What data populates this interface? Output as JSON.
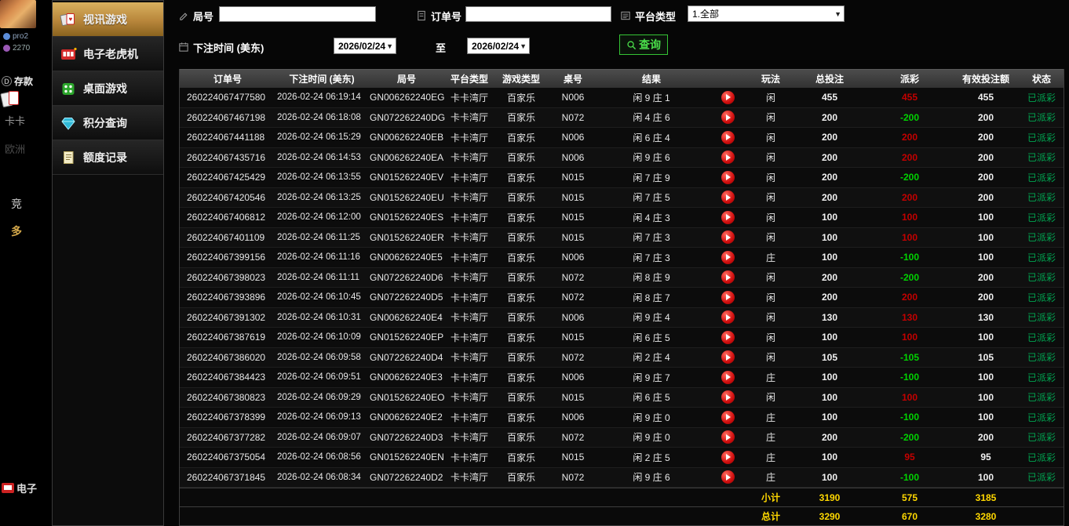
{
  "colors": {
    "accent_gold": "#c9a24f",
    "win_red": "#c40000",
    "loss_green": "#00d300",
    "status_green": "#00a651",
    "summary_yellow": "#ffd800",
    "search_green": "#35c435"
  },
  "background": {
    "username": "pro2",
    "user_id": "2270",
    "deposit_label": "存款",
    "nav_fragments": [
      "卡卡",
      "欧洲",
      "竞",
      "多"
    ],
    "bottom_label": "电子"
  },
  "sidebar": {
    "items": [
      {
        "label": "视讯游戏"
      },
      {
        "label": "电子老虎机"
      },
      {
        "label": "桌面游戏"
      },
      {
        "label": "积分查询"
      },
      {
        "label": "额度记录"
      }
    ]
  },
  "filters": {
    "round_label": "局号",
    "order_label": "订单号",
    "platform_label": "平台类型",
    "platform_value": "1.全部",
    "bet_time_label": "下注时间 (美东)",
    "date_from": "2026/02/24",
    "to_label": "至",
    "date_to": "2026/02/24",
    "search_label": "查询"
  },
  "table": {
    "headers": [
      "订单号",
      "下注时间 (美东)",
      "局号",
      "平台类型",
      "游戏类型",
      "桌号",
      "结果",
      "",
      "玩法",
      "总投注",
      "派彩",
      "有效投注额",
      "状态"
    ],
    "rows": [
      {
        "order": "260224067477580",
        "time": "2026-02-24 06:19:14",
        "round": "GN006262240EG",
        "platform": "卡卡湾厅",
        "game": "百家乐",
        "table": "N006",
        "result": "闲 9 庄 1",
        "bet_on": "闲",
        "total": "455",
        "payout": "455",
        "sign": "pos",
        "valid": "455",
        "status": "已派彩"
      },
      {
        "order": "260224067467198",
        "time": "2026-02-24 06:18:08",
        "round": "GN072262240DG",
        "platform": "卡卡湾厅",
        "game": "百家乐",
        "table": "N072",
        "result": "闲 4 庄 6",
        "bet_on": "闲",
        "total": "200",
        "payout": "-200",
        "sign": "neg",
        "valid": "200",
        "status": "已派彩"
      },
      {
        "order": "260224067441188",
        "time": "2026-02-24 06:15:29",
        "round": "GN006262240EB",
        "platform": "卡卡湾厅",
        "game": "百家乐",
        "table": "N006",
        "result": "闲 6 庄 4",
        "bet_on": "闲",
        "total": "200",
        "payout": "200",
        "sign": "pos",
        "valid": "200",
        "status": "已派彩"
      },
      {
        "order": "260224067435716",
        "time": "2026-02-24 06:14:53",
        "round": "GN006262240EA",
        "platform": "卡卡湾厅",
        "game": "百家乐",
        "table": "N006",
        "result": "闲 9 庄 6",
        "bet_on": "闲",
        "total": "200",
        "payout": "200",
        "sign": "pos",
        "valid": "200",
        "status": "已派彩"
      },
      {
        "order": "260224067425429",
        "time": "2026-02-24 06:13:55",
        "round": "GN015262240EV",
        "platform": "卡卡湾厅",
        "game": "百家乐",
        "table": "N015",
        "result": "闲 7 庄 9",
        "bet_on": "闲",
        "total": "200",
        "payout": "-200",
        "sign": "neg",
        "valid": "200",
        "status": "已派彩"
      },
      {
        "order": "260224067420546",
        "time": "2026-02-24 06:13:25",
        "round": "GN015262240EU",
        "platform": "卡卡湾厅",
        "game": "百家乐",
        "table": "N015",
        "result": "闲 7 庄 5",
        "bet_on": "闲",
        "total": "200",
        "payout": "200",
        "sign": "pos",
        "valid": "200",
        "status": "已派彩"
      },
      {
        "order": "260224067406812",
        "time": "2026-02-24 06:12:00",
        "round": "GN015262240ES",
        "platform": "卡卡湾厅",
        "game": "百家乐",
        "table": "N015",
        "result": "闲 4 庄 3",
        "bet_on": "闲",
        "total": "100",
        "payout": "100",
        "sign": "pos",
        "valid": "100",
        "status": "已派彩"
      },
      {
        "order": "260224067401109",
        "time": "2026-02-24 06:11:25",
        "round": "GN015262240ER",
        "platform": "卡卡湾厅",
        "game": "百家乐",
        "table": "N015",
        "result": "闲 7 庄 3",
        "bet_on": "闲",
        "total": "100",
        "payout": "100",
        "sign": "pos",
        "valid": "100",
        "status": "已派彩"
      },
      {
        "order": "260224067399156",
        "time": "2026-02-24 06:11:16",
        "round": "GN006262240E5",
        "platform": "卡卡湾厅",
        "game": "百家乐",
        "table": "N006",
        "result": "闲 7 庄 3",
        "bet_on": "庄",
        "total": "100",
        "payout": "-100",
        "sign": "neg",
        "valid": "100",
        "status": "已派彩"
      },
      {
        "order": "260224067398023",
        "time": "2026-02-24 06:11:11",
        "round": "GN072262240D6",
        "platform": "卡卡湾厅",
        "game": "百家乐",
        "table": "N072",
        "result": "闲 8 庄 9",
        "bet_on": "闲",
        "total": "200",
        "payout": "-200",
        "sign": "neg",
        "valid": "200",
        "status": "已派彩"
      },
      {
        "order": "260224067393896",
        "time": "2026-02-24 06:10:45",
        "round": "GN072262240D5",
        "platform": "卡卡湾厅",
        "game": "百家乐",
        "table": "N072",
        "result": "闲 8 庄 7",
        "bet_on": "闲",
        "total": "200",
        "payout": "200",
        "sign": "pos",
        "valid": "200",
        "status": "已派彩"
      },
      {
        "order": "260224067391302",
        "time": "2026-02-24 06:10:31",
        "round": "GN006262240E4",
        "platform": "卡卡湾厅",
        "game": "百家乐",
        "table": "N006",
        "result": "闲 9 庄 4",
        "bet_on": "闲",
        "total": "130",
        "payout": "130",
        "sign": "pos",
        "valid": "130",
        "status": "已派彩"
      },
      {
        "order": "260224067387619",
        "time": "2026-02-24 06:10:09",
        "round": "GN015262240EP",
        "platform": "卡卡湾厅",
        "game": "百家乐",
        "table": "N015",
        "result": "闲 6 庄 5",
        "bet_on": "闲",
        "total": "100",
        "payout": "100",
        "sign": "pos",
        "valid": "100",
        "status": "已派彩"
      },
      {
        "order": "260224067386020",
        "time": "2026-02-24 06:09:58",
        "round": "GN072262240D4",
        "platform": "卡卡湾厅",
        "game": "百家乐",
        "table": "N072",
        "result": "闲 2 庄 4",
        "bet_on": "闲",
        "total": "105",
        "payout": "-105",
        "sign": "neg",
        "valid": "105",
        "status": "已派彩"
      },
      {
        "order": "260224067384423",
        "time": "2026-02-24 06:09:51",
        "round": "GN006262240E3",
        "platform": "卡卡湾厅",
        "game": "百家乐",
        "table": "N006",
        "result": "闲 9 庄 7",
        "bet_on": "庄",
        "total": "100",
        "payout": "-100",
        "sign": "neg",
        "valid": "100",
        "status": "已派彩"
      },
      {
        "order": "260224067380823",
        "time": "2026-02-24 06:09:29",
        "round": "GN015262240EO",
        "platform": "卡卡湾厅",
        "game": "百家乐",
        "table": "N015",
        "result": "闲 6 庄 5",
        "bet_on": "闲",
        "total": "100",
        "payout": "100",
        "sign": "pos",
        "valid": "100",
        "status": "已派彩"
      },
      {
        "order": "260224067378399",
        "time": "2026-02-24 06:09:13",
        "round": "GN006262240E2",
        "platform": "卡卡湾厅",
        "game": "百家乐",
        "table": "N006",
        "result": "闲 9 庄 0",
        "bet_on": "庄",
        "total": "100",
        "payout": "-100",
        "sign": "neg",
        "valid": "100",
        "status": "已派彩"
      },
      {
        "order": "260224067377282",
        "time": "2026-02-24 06:09:07",
        "round": "GN072262240D3",
        "platform": "卡卡湾厅",
        "game": "百家乐",
        "table": "N072",
        "result": "闲 9 庄 0",
        "bet_on": "庄",
        "total": "200",
        "payout": "-200",
        "sign": "neg",
        "valid": "200",
        "status": "已派彩"
      },
      {
        "order": "260224067375054",
        "time": "2026-02-24 06:08:56",
        "round": "GN015262240EN",
        "platform": "卡卡湾厅",
        "game": "百家乐",
        "table": "N015",
        "result": "闲 2 庄 5",
        "bet_on": "庄",
        "total": "100",
        "payout": "95",
        "sign": "pos",
        "valid": "95",
        "status": "已派彩"
      },
      {
        "order": "260224067371845",
        "time": "2026-02-24 06:08:34",
        "round": "GN072262240D2",
        "platform": "卡卡湾厅",
        "game": "百家乐",
        "table": "N072",
        "result": "闲 9 庄 6",
        "bet_on": "庄",
        "total": "100",
        "payout": "-100",
        "sign": "neg",
        "valid": "100",
        "status": "已派彩"
      }
    ],
    "subtotal": {
      "label": "小计",
      "total": "3190",
      "payout": "575",
      "valid": "3185"
    },
    "grand_total": {
      "label": "总计",
      "total": "3290",
      "payout": "670",
      "valid": "3280"
    }
  }
}
